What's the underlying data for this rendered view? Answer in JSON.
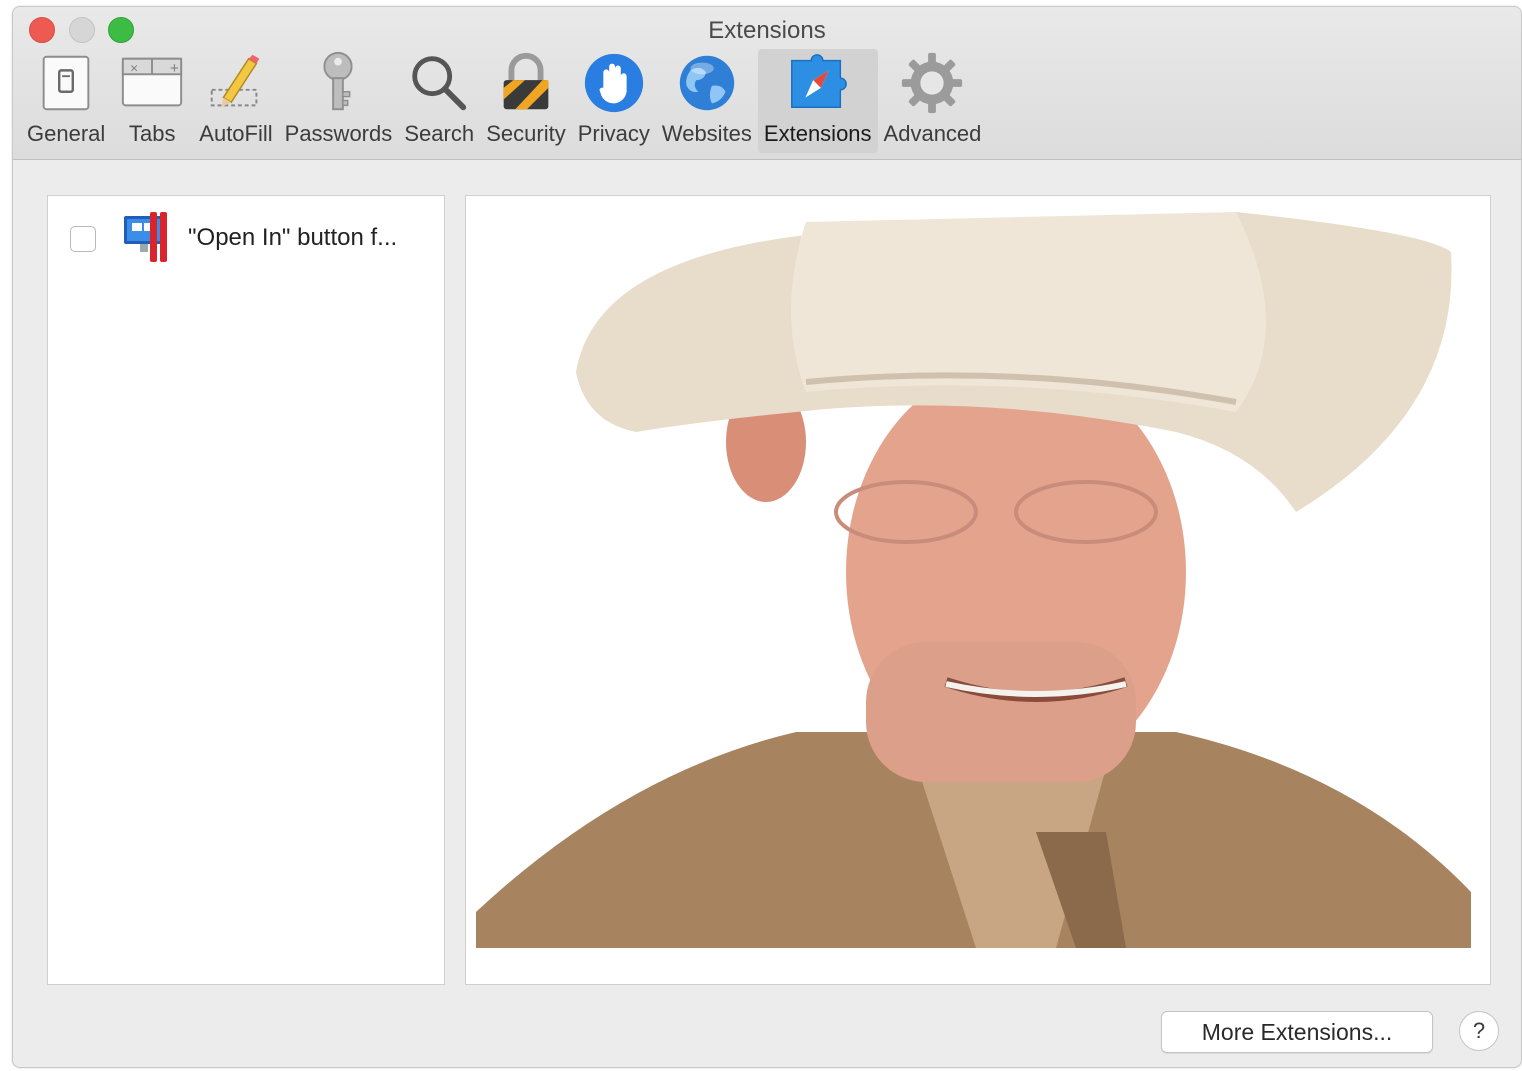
{
  "window": {
    "title": "Extensions"
  },
  "toolbar": {
    "items": [
      {
        "label": "General",
        "icon": "general-icon"
      },
      {
        "label": "Tabs",
        "icon": "tabs-icon"
      },
      {
        "label": "AutoFill",
        "icon": "autofill-pencil-icon"
      },
      {
        "label": "Passwords",
        "icon": "key-icon"
      },
      {
        "label": "Search",
        "icon": "magnifier-icon"
      },
      {
        "label": "Security",
        "icon": "padlock-icon"
      },
      {
        "label": "Privacy",
        "icon": "hand-icon"
      },
      {
        "label": "Websites",
        "icon": "globe-icon"
      },
      {
        "label": "Extensions",
        "icon": "puzzle-compass-icon",
        "selected": true
      },
      {
        "label": "Advanced",
        "icon": "gear-icon"
      }
    ]
  },
  "extensions": {
    "items": [
      {
        "name": "\"Open In\" button f...",
        "enabled": false,
        "icon": "parallels-icon"
      }
    ]
  },
  "detail": {
    "image": "portrait-photo"
  },
  "footer": {
    "more_extensions_label": "More Extensions...",
    "help_label": "?"
  },
  "colors": {
    "close": "#ed5a52",
    "minimize": "#d6d6d6",
    "zoom": "#3cbc44",
    "selected_tab": "#d2d2d2"
  }
}
